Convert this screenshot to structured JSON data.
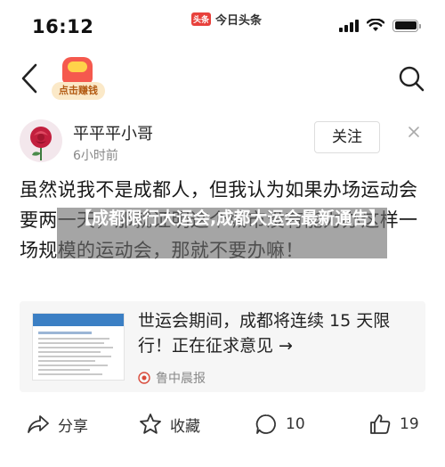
{
  "status_bar": {
    "time": "16:12",
    "app_logo_text": "头条",
    "app_name": "今日头条",
    "battery_level": 1.0
  },
  "nav": {
    "back_icon": "chevron-left-icon",
    "promo_label": "点击赚钱",
    "search_icon": "search-icon"
  },
  "author": {
    "name": "平平平小哥",
    "time": "6小时前",
    "follow_label": "关注",
    "close_icon": "close-icon"
  },
  "post": {
    "text": "虽然说我不是成都人，但我认为如果办场运动会要两一天，那就证明这个城市没有能力办这样一场规模的运动会，那就不要办嘛！"
  },
  "overlay": {
    "text": "【成都限行大运会,成都大运会最新通告】"
  },
  "link_card": {
    "title": "世运会期间，成都将连续 15 天限行！正在征求意见 →",
    "source": "鲁中晨报"
  },
  "actions": {
    "share_label": "分享",
    "favorite_label": "收藏",
    "comment_count": "10",
    "like_count": "19"
  },
  "colors": {
    "brand_red": "#e8413c",
    "overlay_gray": "#6e6e6e",
    "card_bg": "#f6f6f6"
  }
}
